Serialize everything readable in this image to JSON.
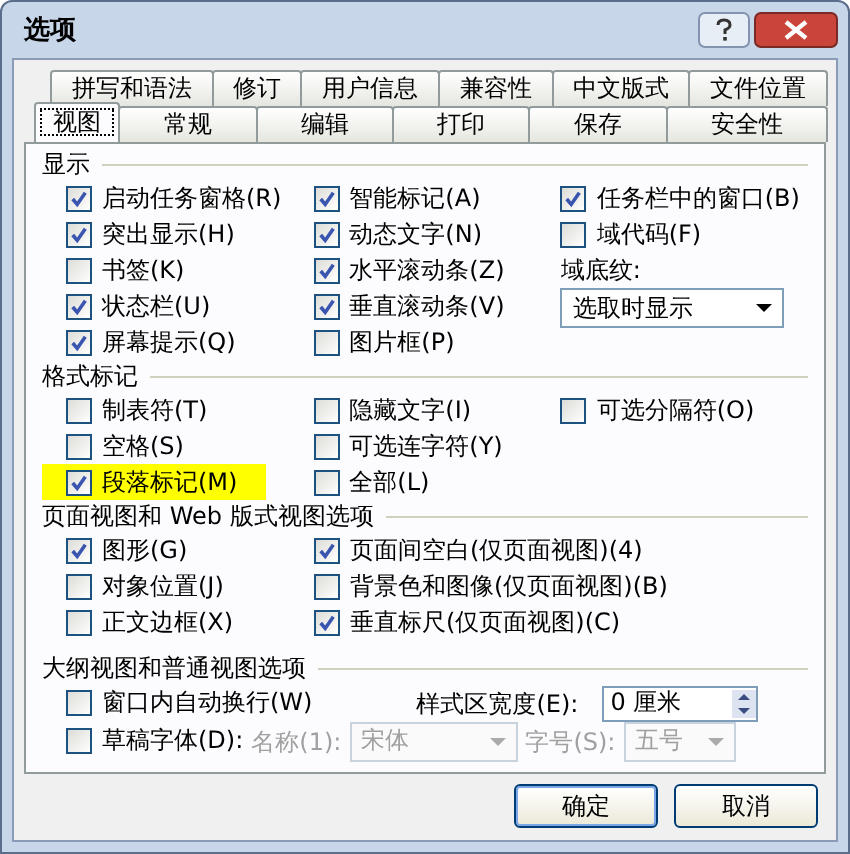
{
  "window": {
    "title": "选项"
  },
  "tabs": [
    [
      {
        "label": "拼写和语法",
        "selected": false
      },
      {
        "label": "修订",
        "selected": false
      },
      {
        "label": "用户信息",
        "selected": false
      },
      {
        "label": "兼容性",
        "selected": false
      },
      {
        "label": "中文版式",
        "selected": false
      },
      {
        "label": "文件位置",
        "selected": false
      }
    ],
    [
      {
        "label": "视图",
        "selected": true
      },
      {
        "label": "常规",
        "selected": false
      },
      {
        "label": "编辑",
        "selected": false
      },
      {
        "label": "打印",
        "selected": false
      },
      {
        "label": "保存",
        "selected": false
      },
      {
        "label": "安全性",
        "selected": false
      }
    ]
  ],
  "sections": [
    {
      "title": "显示",
      "columns": [
        [
          {
            "kind": "checkbox",
            "label": "启动任务窗格(R)",
            "checked": true
          },
          {
            "kind": "checkbox",
            "label": "突出显示(H)",
            "checked": true
          },
          {
            "kind": "checkbox",
            "label": "书签(K)",
            "checked": false
          },
          {
            "kind": "checkbox",
            "label": "状态栏(U)",
            "checked": true
          },
          {
            "kind": "checkbox",
            "label": "屏幕提示(Q)",
            "checked": true
          }
        ],
        [
          {
            "kind": "checkbox",
            "label": "智能标记(A)",
            "checked": true
          },
          {
            "kind": "checkbox",
            "label": "动态文字(N)",
            "checked": true
          },
          {
            "kind": "checkbox",
            "label": "水平滚动条(Z)",
            "checked": true
          },
          {
            "kind": "checkbox",
            "label": "垂直滚动条(V)",
            "checked": true
          },
          {
            "kind": "checkbox",
            "label": "图片框(P)",
            "checked": false
          }
        ],
        [
          {
            "kind": "checkbox",
            "label": "任务栏中的窗口(B)",
            "checked": true
          },
          {
            "kind": "checkbox",
            "label": "域代码(F)",
            "checked": false
          },
          {
            "kind": "label",
            "label": "域底纹:"
          },
          {
            "kind": "dropdown",
            "value": "选取时显示"
          }
        ]
      ]
    },
    {
      "title": "格式标记",
      "columns": [
        [
          {
            "kind": "checkbox",
            "label": "制表符(T)",
            "checked": false,
            "highlighted": false
          },
          {
            "kind": "checkbox",
            "label": "空格(S)",
            "checked": false,
            "highlighted": false
          },
          {
            "kind": "checkbox",
            "label": "段落标记(M)",
            "checked": true,
            "highlighted": true
          }
        ],
        [
          {
            "kind": "checkbox",
            "label": "隐藏文字(I)",
            "checked": false,
            "highlighted": false
          },
          {
            "kind": "checkbox",
            "label": "可选连字符(Y)",
            "checked": false,
            "highlighted": false
          },
          {
            "kind": "checkbox",
            "label": "全部(L)",
            "checked": false,
            "highlighted": false
          }
        ],
        [
          {
            "kind": "checkbox",
            "label": "可选分隔符(O)",
            "checked": false,
            "highlighted": false
          }
        ]
      ]
    },
    {
      "title": "页面视图和 Web 版式视图选项",
      "columns": [
        [
          {
            "kind": "checkbox",
            "label": "图形(G)",
            "checked": true
          },
          {
            "kind": "checkbox",
            "label": "对象位置(J)",
            "checked": false
          },
          {
            "kind": "checkbox",
            "label": "正文边框(X)",
            "checked": false
          }
        ],
        [
          {
            "kind": "checkbox",
            "label": "页面间空白(仅页面视图)(4)",
            "checked": true
          },
          {
            "kind": "checkbox",
            "label": "背景色和图像(仅页面视图)(B)",
            "checked": false
          },
          {
            "kind": "checkbox",
            "label": "垂直标尺(仅页面视图)(C)",
            "checked": true
          }
        ]
      ]
    }
  ],
  "outline": {
    "title": "大纲视图和普通视图选项",
    "word_wrap": {
      "label": "窗口内自动换行(W)",
      "checked": false
    },
    "style_area_width": {
      "label": "样式区宽度(E):",
      "value": "0 厘米"
    },
    "draft_font": {
      "label": "草稿字体(D):",
      "checked": false
    },
    "font_name": {
      "label": "名称(1):",
      "value": "宋体",
      "disabled": true
    },
    "font_size": {
      "label": "字号(S):",
      "value": "五号",
      "disabled": true
    }
  },
  "buttons": [
    {
      "label": "确定",
      "default": true
    },
    {
      "label": "取消",
      "default": false
    }
  ]
}
